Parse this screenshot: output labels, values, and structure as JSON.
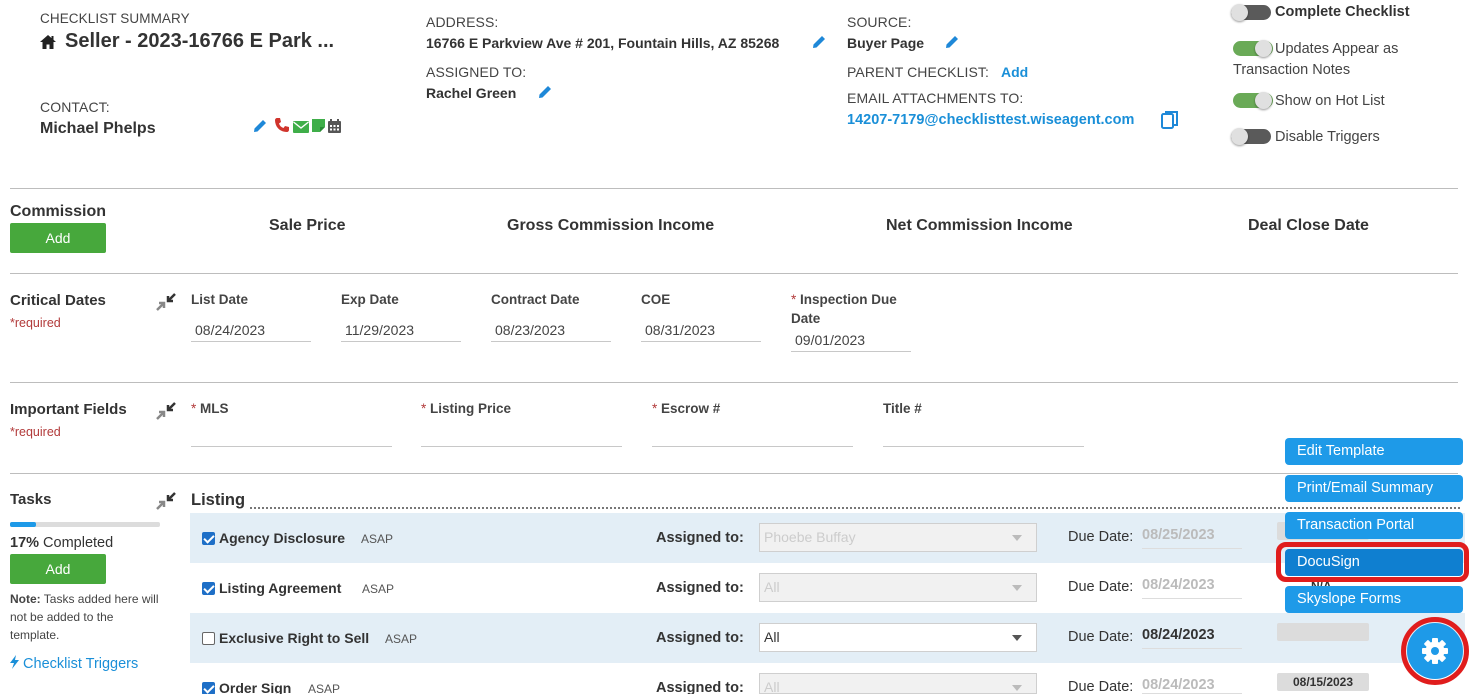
{
  "header": {
    "summary_label": "CHECKLIST SUMMARY",
    "title": "Seller - 2023-16766 E Park ...",
    "contact_label": "CONTACT:",
    "contact_name": "Michael Phelps",
    "address_label": "ADDRESS:",
    "address_value": "16766 E Parkview Ave # 201, Fountain Hills, AZ 85268",
    "assigned_label": "ASSIGNED TO:",
    "assigned_value": "Rachel Green",
    "source_label": "SOURCE:",
    "source_value": "Buyer Page",
    "parent_label": "PARENT CHECKLIST:",
    "parent_link": "Add",
    "email_label": "EMAIL ATTACHMENTS TO:",
    "email_value": "14207-7179@checklisttest.wiseagent.com"
  },
  "toggles": [
    {
      "label": "Complete Checklist",
      "on": false
    },
    {
      "label": "Updates Appear as",
      "label2": "Transaction Notes",
      "on": true
    },
    {
      "label": "Show on Hot List",
      "on": true
    },
    {
      "label": "Disable Triggers",
      "on": false
    }
  ],
  "commission": {
    "title": "Commission",
    "add_label": "Add",
    "columns": [
      "Sale Price",
      "Gross Commission Income",
      "Net Commission Income",
      "Deal Close Date"
    ]
  },
  "critical_dates": {
    "title": "Critical Dates",
    "required": "*required",
    "fields": [
      {
        "label": "List Date",
        "value": "08/24/2023",
        "required": false
      },
      {
        "label": "Exp Date",
        "value": "11/29/2023",
        "required": false
      },
      {
        "label": "Contract Date",
        "value": "08/23/2023",
        "required": false
      },
      {
        "label": "COE",
        "value": "08/31/2023",
        "required": false
      },
      {
        "label": "Inspection Due",
        "label2": "Date",
        "value": "09/01/2023",
        "required": true
      }
    ]
  },
  "important_fields": {
    "title": "Important Fields",
    "required": "*required",
    "fields": [
      {
        "label": "MLS",
        "required": true
      },
      {
        "label": "Listing Price",
        "required": true
      },
      {
        "label": "Escrow #",
        "required": true
      },
      {
        "label": "Title #",
        "required": false
      }
    ]
  },
  "tasks": {
    "title": "Tasks",
    "progress_percent": 17,
    "progress_bold": "17%",
    "progress_text": " Completed",
    "add_label": "Add",
    "note_bold": "Note:",
    "note_line1": " Tasks added here will",
    "note_line2": "not be added to the",
    "note_line3": "template.",
    "triggers_link": "Checklist Triggers",
    "group_title": "Listing",
    "assigned_label": "Assigned to:",
    "due_label": "Due Date:",
    "rows": [
      {
        "name": "Agency Disclosure",
        "tag": "ASAP",
        "checked": true,
        "assignee": "Phoebe Buffay",
        "due": "08/25/2023",
        "disabled": true
      },
      {
        "name": "Listing Agreement",
        "tag": "ASAP",
        "checked": true,
        "assignee": "All",
        "due": "08/24/2023",
        "disabled": true
      },
      {
        "name": "Exclusive Right to Sell",
        "tag": "ASAP",
        "checked": false,
        "assignee": "All",
        "due": "08/24/2023",
        "disabled": false
      },
      {
        "name": "Order Sign",
        "tag": "ASAP",
        "checked": true,
        "assignee": "All",
        "due": "08/24/2023",
        "disabled": true
      }
    ],
    "partial_badge": "N/A",
    "last_badge": "08/15/2023"
  },
  "menu": {
    "items": [
      "Edit Template",
      "Print/Email Summary",
      "Transaction Portal",
      "DocuSign",
      "Skyslope Forms"
    ],
    "highlight_index": 3
  },
  "colors": {
    "accent": "#1e9ae8",
    "green": "#47a83c",
    "highlight_ring": "#e01d1d",
    "required": "#b23a3a"
  }
}
